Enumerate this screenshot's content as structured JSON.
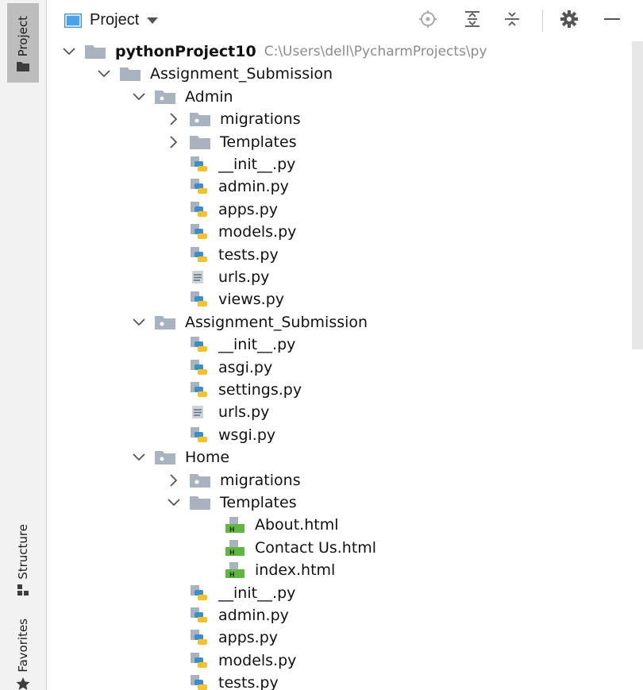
{
  "strip": {
    "project_tab": "Project",
    "structure_tab": "Structure",
    "favorites_tab": "Favorites"
  },
  "toolbar": {
    "view_name": "Project",
    "icons": [
      "locate-icon",
      "expand-all-icon",
      "collapse-all-icon",
      "gear-icon",
      "minimize-icon"
    ]
  },
  "tree": [
    {
      "depth": 0,
      "type": "module",
      "chevron": "down",
      "label": "pythonProject10",
      "bold": true,
      "path": "C:\\Users\\dell\\PycharmProjects\\py"
    },
    {
      "depth": 1,
      "type": "folder",
      "chevron": "down",
      "label": "Assignment_Submission"
    },
    {
      "depth": 2,
      "type": "package",
      "chevron": "down",
      "label": "Admin"
    },
    {
      "depth": 3,
      "type": "package",
      "chevron": "right",
      "label": "migrations"
    },
    {
      "depth": 3,
      "type": "folder",
      "chevron": "right",
      "label": "Templates"
    },
    {
      "depth": 3,
      "type": "python",
      "chevron": "none",
      "label": "__init__.py"
    },
    {
      "depth": 3,
      "type": "python",
      "chevron": "none",
      "label": "admin.py"
    },
    {
      "depth": 3,
      "type": "python",
      "chevron": "none",
      "label": "apps.py"
    },
    {
      "depth": 3,
      "type": "python",
      "chevron": "none",
      "label": "models.py"
    },
    {
      "depth": 3,
      "type": "python",
      "chevron": "none",
      "label": "tests.py"
    },
    {
      "depth": 3,
      "type": "text",
      "chevron": "none",
      "label": "urls.py"
    },
    {
      "depth": 3,
      "type": "python",
      "chevron": "none",
      "label": "views.py"
    },
    {
      "depth": 2,
      "type": "package",
      "chevron": "down",
      "label": "Assignment_Submission"
    },
    {
      "depth": 3,
      "type": "python",
      "chevron": "none",
      "label": "__init__.py"
    },
    {
      "depth": 3,
      "type": "python",
      "chevron": "none",
      "label": "asgi.py"
    },
    {
      "depth": 3,
      "type": "python",
      "chevron": "none",
      "label": "settings.py"
    },
    {
      "depth": 3,
      "type": "text",
      "chevron": "none",
      "label": "urls.py"
    },
    {
      "depth": 3,
      "type": "python",
      "chevron": "none",
      "label": "wsgi.py"
    },
    {
      "depth": 2,
      "type": "package",
      "chevron": "down",
      "label": "Home"
    },
    {
      "depth": 3,
      "type": "package",
      "chevron": "right",
      "label": "migrations"
    },
    {
      "depth": 3,
      "type": "folder",
      "chevron": "down",
      "label": "Templates"
    },
    {
      "depth": 4,
      "type": "html",
      "chevron": "none",
      "label": "About.html"
    },
    {
      "depth": 4,
      "type": "html",
      "chevron": "none",
      "label": "Contact Us.html"
    },
    {
      "depth": 4,
      "type": "html",
      "chevron": "none",
      "label": "index.html"
    },
    {
      "depth": 3,
      "type": "python",
      "chevron": "none",
      "label": "__init__.py"
    },
    {
      "depth": 3,
      "type": "python",
      "chevron": "none",
      "label": "admin.py"
    },
    {
      "depth": 3,
      "type": "python",
      "chevron": "none",
      "label": "apps.py"
    },
    {
      "depth": 3,
      "type": "python",
      "chevron": "none",
      "label": "models.py"
    },
    {
      "depth": 3,
      "type": "python",
      "chevron": "none",
      "label": "tests.py"
    }
  ],
  "colors": {
    "folder": "#a9b3bf",
    "python_blue": "#3c8dc8",
    "python_yellow": "#f2c230",
    "html_green": "#62b543",
    "strip_bg": "#f2f2f2",
    "active_tab": "#bdbdbd"
  }
}
